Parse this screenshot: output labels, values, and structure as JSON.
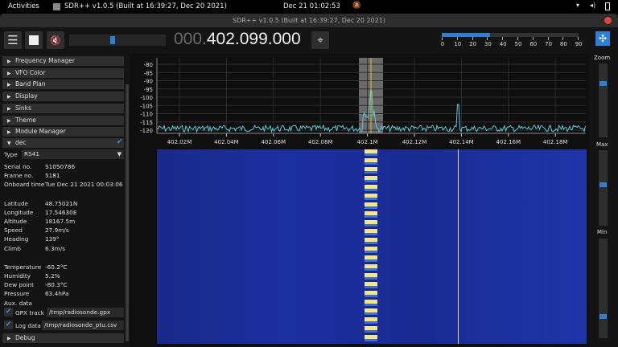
{
  "topbar": {
    "activities": "Activities",
    "app": "SDR++ v1.0.5 (Built at 16:39:27, Dec 20 2021)",
    "clock": "Dec 21  01:02:53"
  },
  "window": {
    "title": "SDR++ v1.0.5 (Built at 16:39:27, Dec 20 2021)"
  },
  "toolbar": {
    "freq_dim": "000.",
    "freq": "402.099.000",
    "volume_fraction": 0.45,
    "snr_fraction": 0.32,
    "snr_ticks": [
      "0",
      "10",
      "20",
      "30",
      "40",
      "50",
      "60",
      "70",
      "80",
      "90"
    ]
  },
  "menu": [
    "Frequency Manager",
    "VFO Color",
    "Band Plan",
    "Display",
    "Sinks",
    "Theme",
    "Module Manager"
  ],
  "dec": {
    "title": "dec",
    "type_label": "Type",
    "type_value": "RS41",
    "rows1": [
      [
        "Serial no.",
        "S1050786"
      ],
      [
        "Frame no.",
        "5181"
      ],
      [
        "Onboard time",
        "Tue Dec 21 2021 00:03:06"
      ]
    ],
    "rows2": [
      [
        "Latitude",
        "48.75021N"
      ],
      [
        "Longitude",
        "17.54630E"
      ],
      [
        "Altitude",
        "18167.5m"
      ],
      [
        "Speed",
        "27.9m/s"
      ],
      [
        "Heading",
        "139°"
      ],
      [
        "Climb",
        "6.3m/s"
      ]
    ],
    "rows3": [
      [
        "Temperature",
        "-60.2°C"
      ],
      [
        "Humidity",
        "5.2%"
      ],
      [
        "Dew point",
        "-80.3°C"
      ],
      [
        "Pressure",
        "63.4hPa"
      ],
      [
        "Aux. data",
        ""
      ]
    ],
    "gpx_label": "GPX track",
    "gpx_path": "/tmp/radiosonde.gpx",
    "log_label": "Log data",
    "log_path": "/tmp/radiosonde_ptu.csv",
    "debug": "Debug"
  },
  "spectrum": {
    "db_ticks": [
      "-80",
      "-85",
      "-90",
      "-95",
      "-100",
      "-105",
      "-110",
      "-115",
      "-120"
    ],
    "freq_ticks": [
      "402.02M",
      "402.04M",
      "402.06M",
      "402.08M",
      "402.1M",
      "402.12M",
      "402.14M",
      "402.16M",
      "402.18M"
    ]
  },
  "right": {
    "zoom": "Zoom",
    "max": "Max",
    "min": "Min",
    "zoom_fraction": 0.25,
    "max_fraction": 0.45,
    "min_fraction": 0.8
  },
  "colors": {
    "accent": "#2f7fd6",
    "trace": "#5fc8d8"
  }
}
